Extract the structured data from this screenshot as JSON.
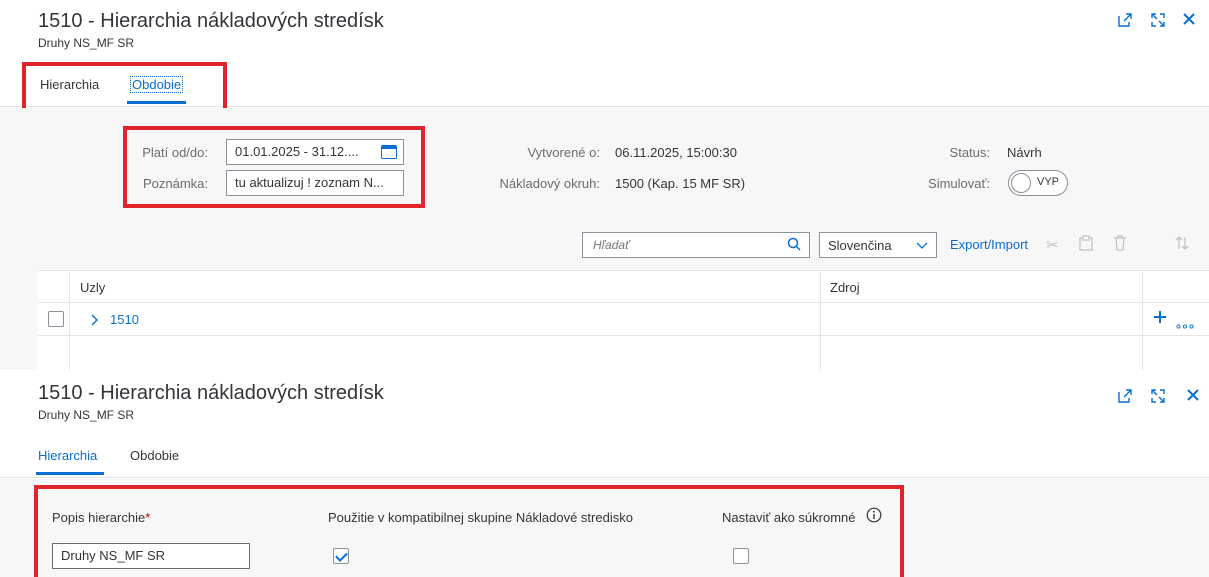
{
  "panel1": {
    "title": "1510 - Hierarchia nákladových stredísk",
    "subtitle": "Druhy NS_MF SR",
    "tabs": [
      {
        "label": "Hierarchia"
      },
      {
        "label": "Obdobie"
      }
    ],
    "form": {
      "valid_label": "Platí od/do:",
      "valid_value": "01.01.2025 - 31.12....",
      "note_label": "Poznámka:",
      "note_value": "tu aktualizuj ! zoznam N...",
      "created_label": "Vytvorené o:",
      "created_value": "06.11.2025, 15:00:30",
      "cost_area_label": "Nákladový okruh:",
      "cost_area_value": "1500 (Kap. 15 MF SR)",
      "status_label": "Status:",
      "status_value": "Návrh",
      "simulate_label": "Simulovať:",
      "simulate_value": "VYP"
    },
    "toolbar": {
      "search_placeholder": "Hľadať",
      "language": "Slovenčina",
      "export_import": "Export/Import"
    },
    "table": {
      "columns": [
        "Uzly",
        "Zdroj"
      ],
      "rows": [
        {
          "node": "1510",
          "source": ""
        }
      ]
    }
  },
  "panel2": {
    "title": "1510 - Hierarchia nákladových stredísk",
    "subtitle": "Druhy NS_MF SR",
    "tabs": [
      {
        "label": "Hierarchia"
      },
      {
        "label": "Obdobie"
      }
    ],
    "form": {
      "desc_label": "Popis hierarchie",
      "required_mark": "*",
      "desc_value": "Druhy NS_MF SR",
      "compat_label": "Použitie v kompatibilnej skupine Nákladové stredisko",
      "compat_checked": true,
      "private_label": "Nastaviť ako súkromné",
      "private_checked": false
    }
  },
  "colors": {
    "accent": "#0a6ed1",
    "highlight": "#e0242b",
    "text": "#32363a",
    "muted": "#6a6d70"
  }
}
